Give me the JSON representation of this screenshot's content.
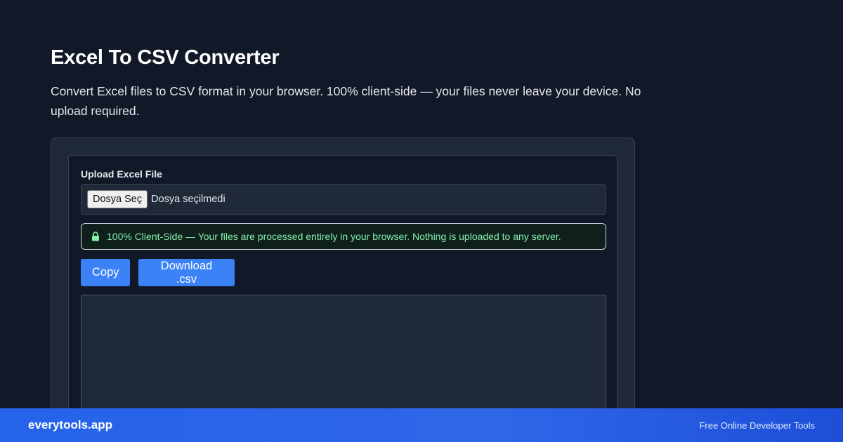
{
  "header": {
    "title": "Excel To CSV Converter",
    "description": "Convert Excel files to CSV format in your browser. 100% client-side — your files never leave your device. No upload required."
  },
  "upload": {
    "label": "Upload Excel File",
    "choose_button": "Dosya Seç",
    "no_file_text": "Dosya seçilmedi"
  },
  "notice": {
    "icon": "lock-icon",
    "text": "100% Client-Side — Your files are processed entirely in your browser. Nothing is uploaded to any server.",
    "color": "#86efac"
  },
  "actions": {
    "copy_label": "Copy",
    "download_label": "Download .csv",
    "accent_color": "#3b82f6"
  },
  "output": {
    "value": ""
  },
  "footer": {
    "brand": "everytools.app",
    "tagline": "Free Online Developer Tools"
  }
}
